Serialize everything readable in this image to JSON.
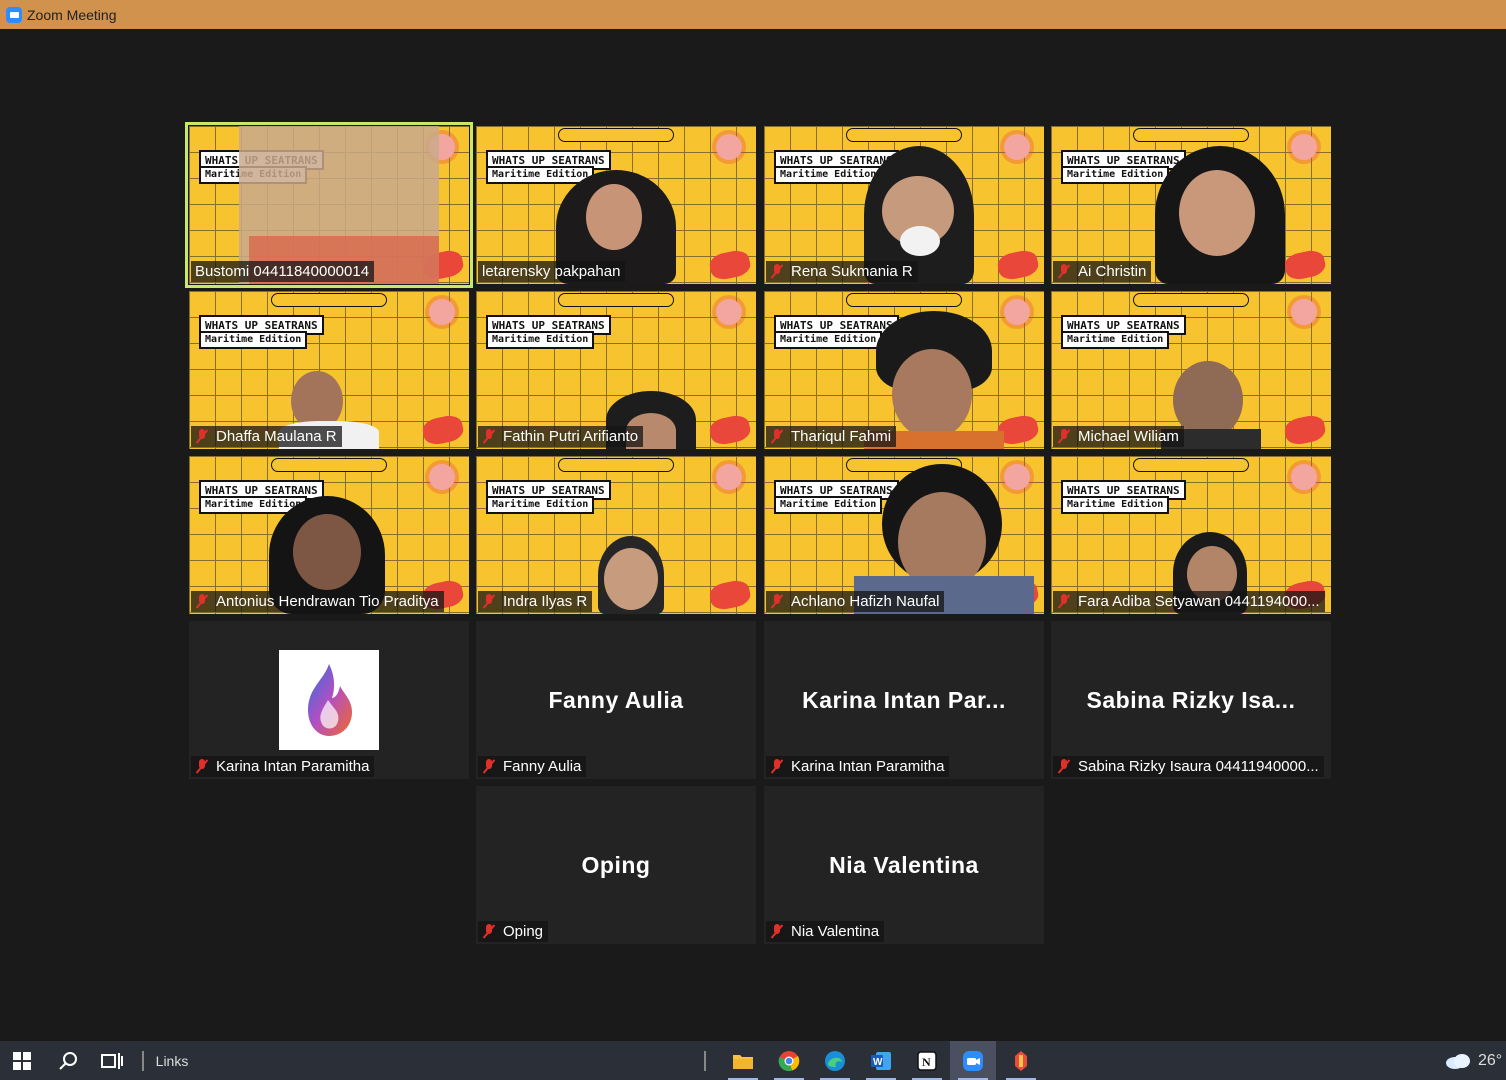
{
  "window": {
    "title": "Zoom Meeting"
  },
  "banner": {
    "line1": "WHATS UP SEATRANS",
    "line2": "Maritime Edition"
  },
  "participants": [
    {
      "name": "Bustomi 04411840000014",
      "muted": false,
      "active": true
    },
    {
      "name": "letarensky pakpahan",
      "muted": false
    },
    {
      "name": "Rena Sukmania R",
      "muted": true
    },
    {
      "name": "Ai Christin",
      "muted": true
    },
    {
      "name": "Dhaffa Maulana R",
      "muted": true
    },
    {
      "name": "Fathin Putri Arifianto",
      "muted": true
    },
    {
      "name": "Thariqul Fahmi",
      "muted": true
    },
    {
      "name": "Michael Wiliam",
      "muted": true
    },
    {
      "name": "Antonius Hendrawan Tio Praditya",
      "muted": true
    },
    {
      "name": "Indra Ilyas R",
      "muted": true
    },
    {
      "name": "Achlano Hafizh Naufal",
      "muted": true
    },
    {
      "name": "Fara Adiba Setyawan 0441194000...",
      "muted": true
    },
    {
      "name": "Karina Intan Paramitha",
      "muted": true,
      "avatar": "fire-logo"
    },
    {
      "name": "Fanny Aulia",
      "muted": true,
      "display": "Fanny Aulia"
    },
    {
      "name": "Karina Intan Paramitha",
      "muted": true,
      "display": "Karina Intan Par..."
    },
    {
      "name": "Sabina Rizky Isaura 04411940000...",
      "muted": true,
      "display": "Sabina Rizky Isa..."
    },
    {
      "name": "Oping",
      "muted": true,
      "display": "Oping"
    },
    {
      "name": "Nia Valentina",
      "muted": true,
      "display": "Nia Valentina"
    }
  ],
  "taskbar": {
    "links_label": "Links",
    "temperature": "26°",
    "apps": [
      "file-explorer",
      "chrome",
      "edge",
      "word",
      "notion",
      "zoom",
      "powertoys"
    ]
  },
  "colors": {
    "accent_border": "#c9e86a",
    "title_bar": "#d0924c",
    "background_yellow": "#f7c32e",
    "mute_red": "#e0302a"
  }
}
